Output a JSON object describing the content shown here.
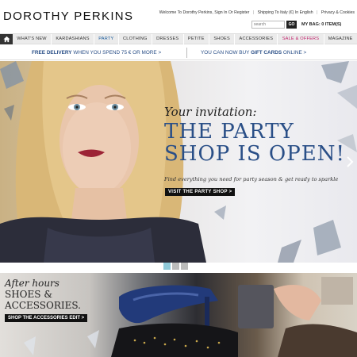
{
  "header": {
    "logo": "DOROTHY PERKINS",
    "welcome": "Welcome To Dorothy Perkins, Sign In Or Register",
    "shipping": "Shipping To Italy (€) In English",
    "privacy": "Privacy & Cookies",
    "search_placeholder": "search",
    "go_label": "GO",
    "bag": "MY BAG: 0 ITEM(S)"
  },
  "nav": {
    "items": [
      "WHAT'S NEW",
      "KARDASHIANS",
      "PARTY",
      "CLOTHING",
      "DRESSES",
      "PETITE",
      "SHOES",
      "ACCESSORIES",
      "SALE & OFFERS",
      "MAGAZINE"
    ]
  },
  "promo": {
    "left_bold": "FREE DELIVERY",
    "left_text": " WHEN YOU SPEND 75 € OR MORE >",
    "right_text": "YOU CAN NOW BUY ",
    "right_bold": "GIFT CARDS",
    "right_text2": " ONLINE >"
  },
  "hero": {
    "invitation": "Your invitation:",
    "headline_line1": "THE PARTY",
    "headline_line2": "SHOP IS OPEN!",
    "subtext": "Find everything you need for party season & get ready to sparkle",
    "cta": "VISIT THE PARTY SHOP >"
  },
  "carousel": {
    "slide_count": 3,
    "active": 1
  },
  "promo2": {
    "line1": "After hours",
    "line2": "SHOES &",
    "line3": "ACCESSORIES.",
    "cta": "SHOP THE ACCESSORIES EDIT >"
  },
  "colors": {
    "brand_blue": "#2a4f87",
    "sale_pink": "#c0246c",
    "carousel_active": "#8fc9d9"
  }
}
